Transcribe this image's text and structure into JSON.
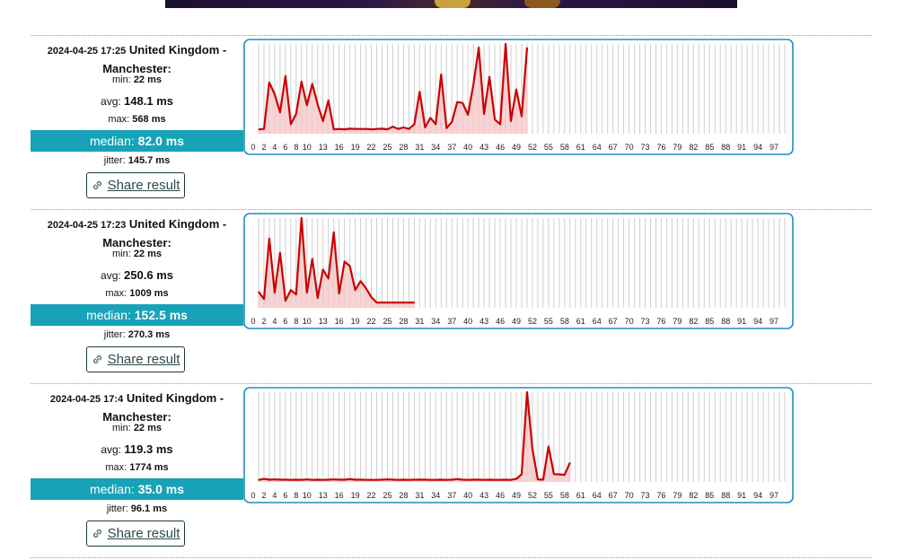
{
  "colors": {
    "accent": "#17a2b8",
    "line": "#cc0000",
    "fill": "#f5c6c6",
    "frame": "#1f8dbb",
    "grid": "#cfcfcf"
  },
  "share_icon": "link-icon",
  "x_ticks": [
    "0",
    "2",
    "4",
    "6",
    "8",
    "10",
    "13",
    "16",
    "19",
    "22",
    "25",
    "28",
    "31",
    "34",
    "37",
    "40",
    "43",
    "46",
    "49",
    "52",
    "55",
    "58",
    "61",
    "64",
    "67",
    "70",
    "73",
    "76",
    "79",
    "82",
    "85",
    "88",
    "91",
    "94",
    "97"
  ],
  "results": [
    {
      "timestamp": "2024-04-25 17:25",
      "location": "United Kingdom - Manchester:",
      "min_label": "min:",
      "min_value": "22 ms",
      "avg_label": "avg:",
      "avg_value": "148.1 ms",
      "max_label": "max:",
      "max_value": "568 ms",
      "median_label": "median:",
      "median_value": "82.0 ms",
      "jitter_label": "jitter:",
      "jitter_value": "145.7 ms",
      "share_label": "Share result"
    },
    {
      "timestamp": "2024-04-25 17:23",
      "location": "United Kingdom - Manchester:",
      "min_label": "min:",
      "min_value": "22 ms",
      "avg_label": "avg:",
      "avg_value": "250.6 ms",
      "max_label": "max:",
      "max_value": "1009 ms",
      "median_label": "median:",
      "median_value": "152.5 ms",
      "jitter_label": "jitter:",
      "jitter_value": "270.3 ms",
      "share_label": "Share result"
    },
    {
      "timestamp": "2024-04-25 17:4",
      "location": "United Kingdom - Manchester:",
      "min_label": "min:",
      "min_value": "22 ms",
      "avg_label": "avg:",
      "avg_value": "119.3 ms",
      "max_label": "max:",
      "max_value": "1774 ms",
      "median_label": "median:",
      "median_value": "35.0 ms",
      "jitter_label": "jitter:",
      "jitter_value": "96.1 ms",
      "share_label": "Share result"
    }
  ],
  "chart_data": [
    {
      "type": "line",
      "xlim": [
        0,
        99
      ],
      "ylim": [
        0,
        568
      ],
      "x_start": 1,
      "values": [
        28,
        30,
        325,
        250,
        135,
        365,
        60,
        125,
        330,
        180,
        315,
        185,
        80,
        210,
        28,
        30,
        28,
        32,
        30,
        30,
        30,
        28,
        30,
        32,
        28,
        45,
        30,
        40,
        30,
        60,
        265,
        40,
        100,
        60,
        375,
        35,
        75,
        200,
        195,
        120,
        310,
        545,
        125,
        360,
        90,
        60,
        568,
        80,
        280,
        110,
        545
      ]
    },
    {
      "type": "line",
      "xlim": [
        0,
        99
      ],
      "ylim": [
        0,
        1009
      ],
      "x_start": 1,
      "values": [
        180,
        100,
        780,
        170,
        620,
        80,
        200,
        150,
        1009,
        170,
        550,
        110,
        430,
        330,
        850,
        160,
        520,
        470,
        200,
        300,
        220,
        120,
        60,
        60,
        60,
        60,
        60,
        60,
        60,
        60
      ]
    },
    {
      "type": "line",
      "xlim": [
        0,
        99
      ],
      "ylim": [
        0,
        1774
      ],
      "x_start": 1,
      "values": [
        40,
        60,
        45,
        50,
        45,
        45,
        40,
        45,
        40,
        50,
        40,
        45,
        40,
        45,
        50,
        45,
        45,
        55,
        45,
        45,
        40,
        40,
        40,
        45,
        50,
        45,
        40,
        45,
        40,
        45,
        45,
        45,
        40,
        40,
        45,
        40,
        45,
        55,
        45,
        40,
        45,
        45,
        40,
        45,
        40,
        40,
        45,
        40,
        60,
        150,
        1774,
        660,
        50,
        45,
        700,
        155,
        150,
        140,
        380
      ]
    }
  ]
}
